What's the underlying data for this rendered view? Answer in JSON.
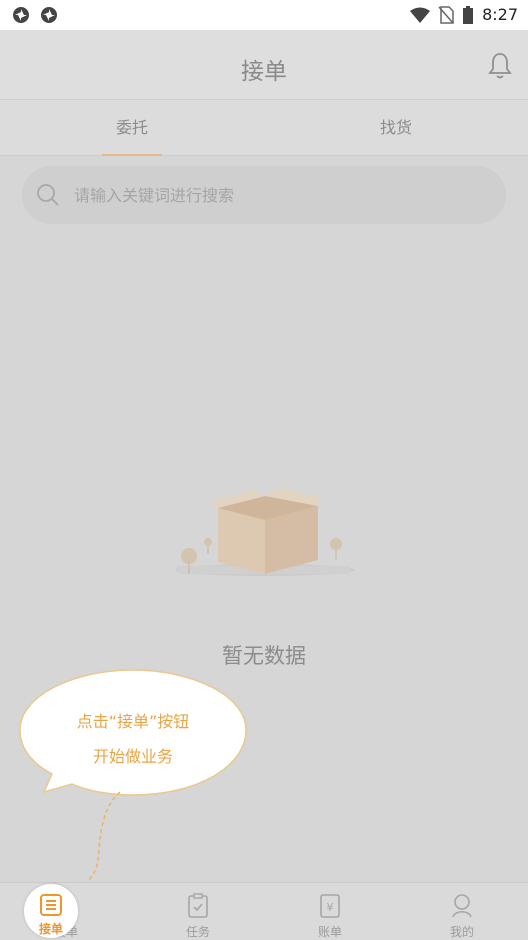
{
  "status_bar": {
    "time": "8:27",
    "left_icons": [
      "app-icon",
      "app-icon"
    ],
    "right_icons": [
      "wifi-icon",
      "no-sim-icon",
      "battery-icon"
    ]
  },
  "header": {
    "title": "接单",
    "icon": "bell-icon"
  },
  "tabs": [
    {
      "label": "委托",
      "active": true
    },
    {
      "label": "找货",
      "active": false
    }
  ],
  "search": {
    "placeholder": "请输入关键词进行搜索",
    "value": ""
  },
  "empty_state": {
    "text": "暂无数据",
    "icon": "empty-box-illustration"
  },
  "tooltip": {
    "line1": "点击“接单”按钮",
    "line2": "开始做业务"
  },
  "bottom_nav": [
    {
      "label": "接单",
      "icon": "list-icon",
      "active": true
    },
    {
      "label": "任务",
      "icon": "clipboard-icon",
      "active": false
    },
    {
      "label": "账单",
      "icon": "bill-icon",
      "active": false
    },
    {
      "label": "我的",
      "icon": "user-icon",
      "active": false
    }
  ],
  "colors": {
    "accent": "#f0962a",
    "overlay_gray": "#d6d6d6",
    "tooltip_text": "#e9a545"
  }
}
